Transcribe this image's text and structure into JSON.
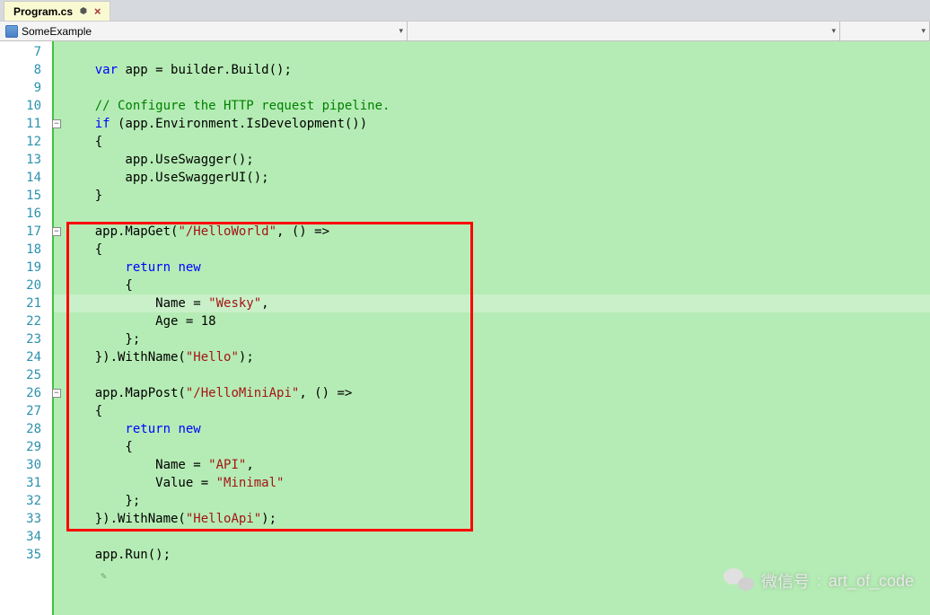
{
  "tab": {
    "name": "Program.cs"
  },
  "breadcrumb": {
    "namespace": "SomeExample"
  },
  "gutter": {
    "start": 7,
    "end": 35
  },
  "code": {
    "l7": "",
    "l8_var": "var",
    "l8_rest": " app = builder.Build();",
    "l9": "",
    "l10_comment": "// Configure the HTTP request pipeline.",
    "l11_if": "if",
    "l11_rest": " (app.Environment.IsDevelopment())",
    "l12": "{",
    "l13": "    app.UseSwagger();",
    "l14": "    app.UseSwaggerUI();",
    "l15": "}",
    "l16": "",
    "l17_a": "app.MapGet(",
    "l17_s": "\"/HelloWorld\"",
    "l17_b": ", () =>",
    "l18": "{",
    "l19_return": "    return",
    "l19_new": " new",
    "l20": "    {",
    "l21_a": "        Name = ",
    "l21_s": "\"Wesky\"",
    "l21_b": ",",
    "l22": "        Age = 18",
    "l23": "    };",
    "l24_a": "}).WithName(",
    "l24_s": "\"Hello\"",
    "l24_b": ");",
    "l25": "",
    "l26_a": "app.MapPost(",
    "l26_s": "\"/HelloMiniApi\"",
    "l26_b": ", () =>",
    "l27": "{",
    "l28_return": "    return",
    "l28_new": " new",
    "l29": "    {",
    "l30_a": "        Name = ",
    "l30_s": "\"API\"",
    "l30_b": ",",
    "l31_a": "        Value = ",
    "l31_s": "\"Minimal\"",
    "l32": "    };",
    "l33_a": "}).WithName(",
    "l33_s": "\"HelloApi\"",
    "l33_b": ");",
    "l34": "",
    "l35": "app.Run();"
  },
  "watermark": {
    "label": "微信号",
    "handle": "art_of_code"
  }
}
